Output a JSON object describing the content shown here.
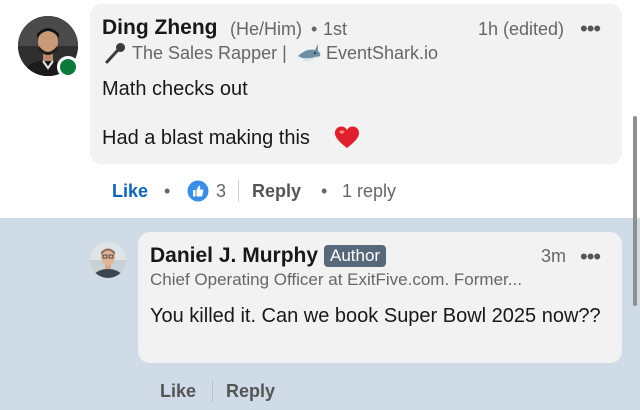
{
  "comment": {
    "author_name": "Ding Zheng",
    "pronouns": "(He/Him)",
    "degree_separator": "•",
    "degree": "1st",
    "timestamp": "1h (edited)",
    "more_label": "•••",
    "headline_part1": "The Sales Rapper |",
    "headline_part2": "EventShark.io",
    "body_line1": "Math checks out",
    "body_line2": "Had a blast making this",
    "actions": {
      "like_label": "Like",
      "dot_separator": "•",
      "reaction_count": "3",
      "reply_label": "Reply",
      "reply_count_label": "1 reply"
    }
  },
  "reply": {
    "author_name": "Daniel J. Murphy",
    "badge": "Author",
    "timestamp": "3m",
    "more_label": "•••",
    "headline": "Chief Operating Officer at ExitFive.com. Former...",
    "body": "You killed it. Can we book Super Bowl 2025 now??",
    "actions": {
      "like_label": "Like",
      "reply_label": "Reply"
    }
  },
  "icons": {
    "microphone": "microphone-icon",
    "shark": "shark-icon",
    "heart": "heart-icon",
    "like_reaction": "thumbs-up-icon",
    "presence": "online-status-icon"
  },
  "colors": {
    "link_blue": "#0a66c2",
    "reply_background": "#cfdbe6",
    "bubble": "#f2f2f2",
    "author_badge": "#56687a",
    "presence_green": "#0a7a3a",
    "heart_red": "#e0202a"
  }
}
